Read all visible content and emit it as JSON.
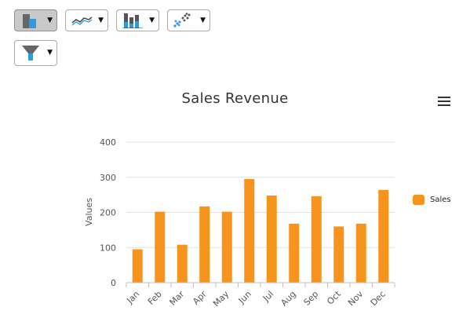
{
  "toolbar": {
    "buttons": [
      {
        "name": "column-chart",
        "active": true,
        "caret": "▼"
      },
      {
        "name": "line-chart",
        "active": false,
        "caret": "▼"
      },
      {
        "name": "stacked-chart",
        "active": false,
        "caret": "▼"
      },
      {
        "name": "scatter-chart",
        "active": false,
        "caret": "▼"
      },
      {
        "name": "funnel-chart",
        "active": false,
        "caret": "▼"
      }
    ]
  },
  "chart_data": {
    "type": "bar",
    "title": "Sales Revenue",
    "ylabel": "Values",
    "xlabel": "",
    "categories": [
      "Jan",
      "Feb",
      "Mar",
      "Apr",
      "May",
      "Jun",
      "Jul",
      "Aug",
      "Sep",
      "Oct",
      "Nov",
      "Dec"
    ],
    "series": [
      {
        "name": "Sales",
        "color": "#f7941d",
        "values": [
          95,
          202,
          108,
          217,
          202,
          295,
          248,
          168,
          246,
          160,
          168,
          264
        ]
      }
    ],
    "ylim": [
      0,
      400
    ],
    "yticks": [
      "0",
      "100",
      "200",
      "300",
      "400"
    ],
    "grid": true,
    "legend_position": "right"
  }
}
